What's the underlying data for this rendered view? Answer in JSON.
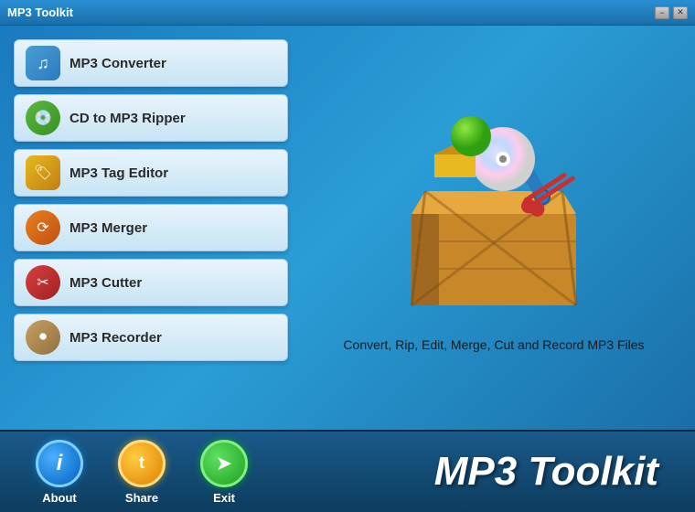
{
  "window": {
    "title": "MP3 Toolkit",
    "min_label": "−",
    "close_label": "✕"
  },
  "menu": {
    "buttons": [
      {
        "id": "mp3-converter",
        "label": "MP3 Converter",
        "icon": "music-note-icon"
      },
      {
        "id": "cd-ripper",
        "label": "CD to MP3 Ripper",
        "icon": "cd-icon"
      },
      {
        "id": "tag-editor",
        "label": "MP3 Tag Editor",
        "icon": "tag-icon"
      },
      {
        "id": "merger",
        "label": "MP3 Merger",
        "icon": "merge-icon"
      },
      {
        "id": "cutter",
        "label": "MP3 Cutter",
        "icon": "scissors-icon"
      },
      {
        "id": "recorder",
        "label": "MP3 Recorder",
        "icon": "record-icon"
      }
    ]
  },
  "tagline": "Convert, Rip, Edit, Merge, Cut and Record MP3 Files",
  "footer": {
    "about_label": "About",
    "share_label": "Share",
    "exit_label": "Exit",
    "title": "MP3 Toolkit",
    "about_icon": "i",
    "share_icon": "t",
    "exit_icon": "➤"
  }
}
